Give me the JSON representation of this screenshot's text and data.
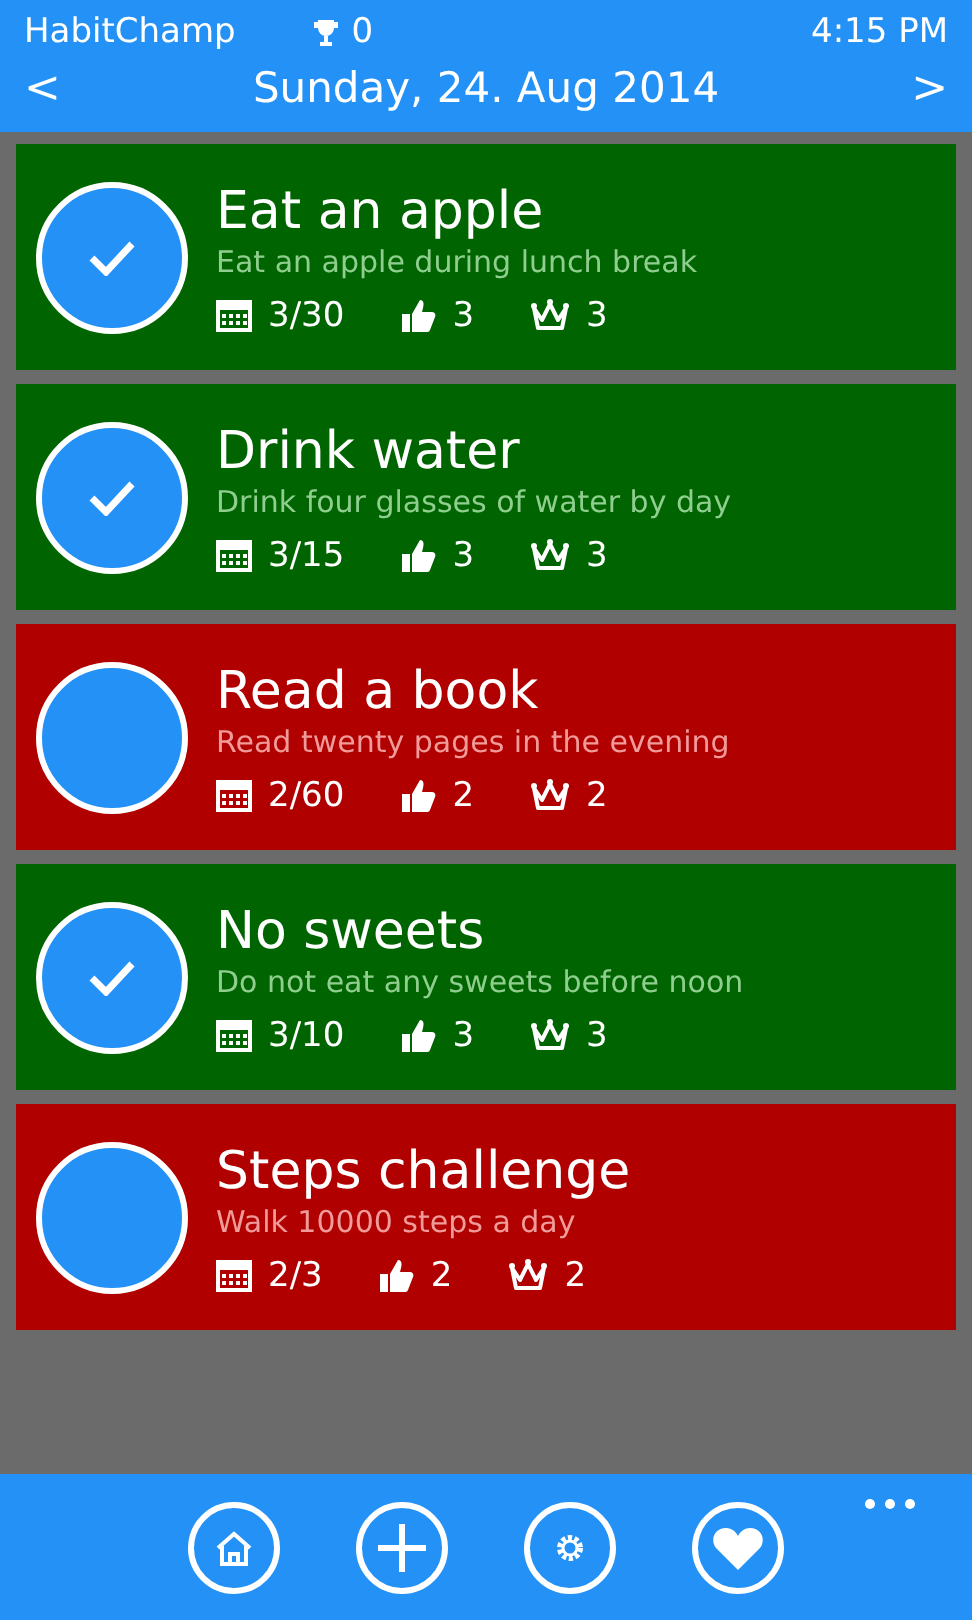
{
  "header": {
    "app_name": "HabitChamp",
    "trophies": "0",
    "time": "4:15 PM",
    "prev": "<",
    "date": "Sunday, 24. Aug 2014",
    "next": ">"
  },
  "habits": [
    {
      "title": "Eat an apple",
      "description": "Eat an apple during lunch break",
      "days": "3/30",
      "likes": "3",
      "crowns": "3",
      "done": true
    },
    {
      "title": "Drink water",
      "description": "Drink four glasses of water by day",
      "days": "3/15",
      "likes": "3",
      "crowns": "3",
      "done": true
    },
    {
      "title": "Read a book",
      "description": "Read twenty pages in the evening",
      "days": "2/60",
      "likes": "2",
      "crowns": "2",
      "done": false
    },
    {
      "title": "No sweets",
      "description": "Do not eat any sweets before noon",
      "days": "3/10",
      "likes": "3",
      "crowns": "3",
      "done": true
    },
    {
      "title": "Steps challenge",
      "description": "Walk 10000 steps a day",
      "days": "2/3",
      "likes": "2",
      "crowns": "2",
      "done": false
    }
  ],
  "app_bar": {
    "buttons": [
      {
        "kind": "home"
      },
      {
        "kind": "add"
      },
      {
        "kind": "settings"
      },
      {
        "kind": "favorite"
      }
    ]
  }
}
